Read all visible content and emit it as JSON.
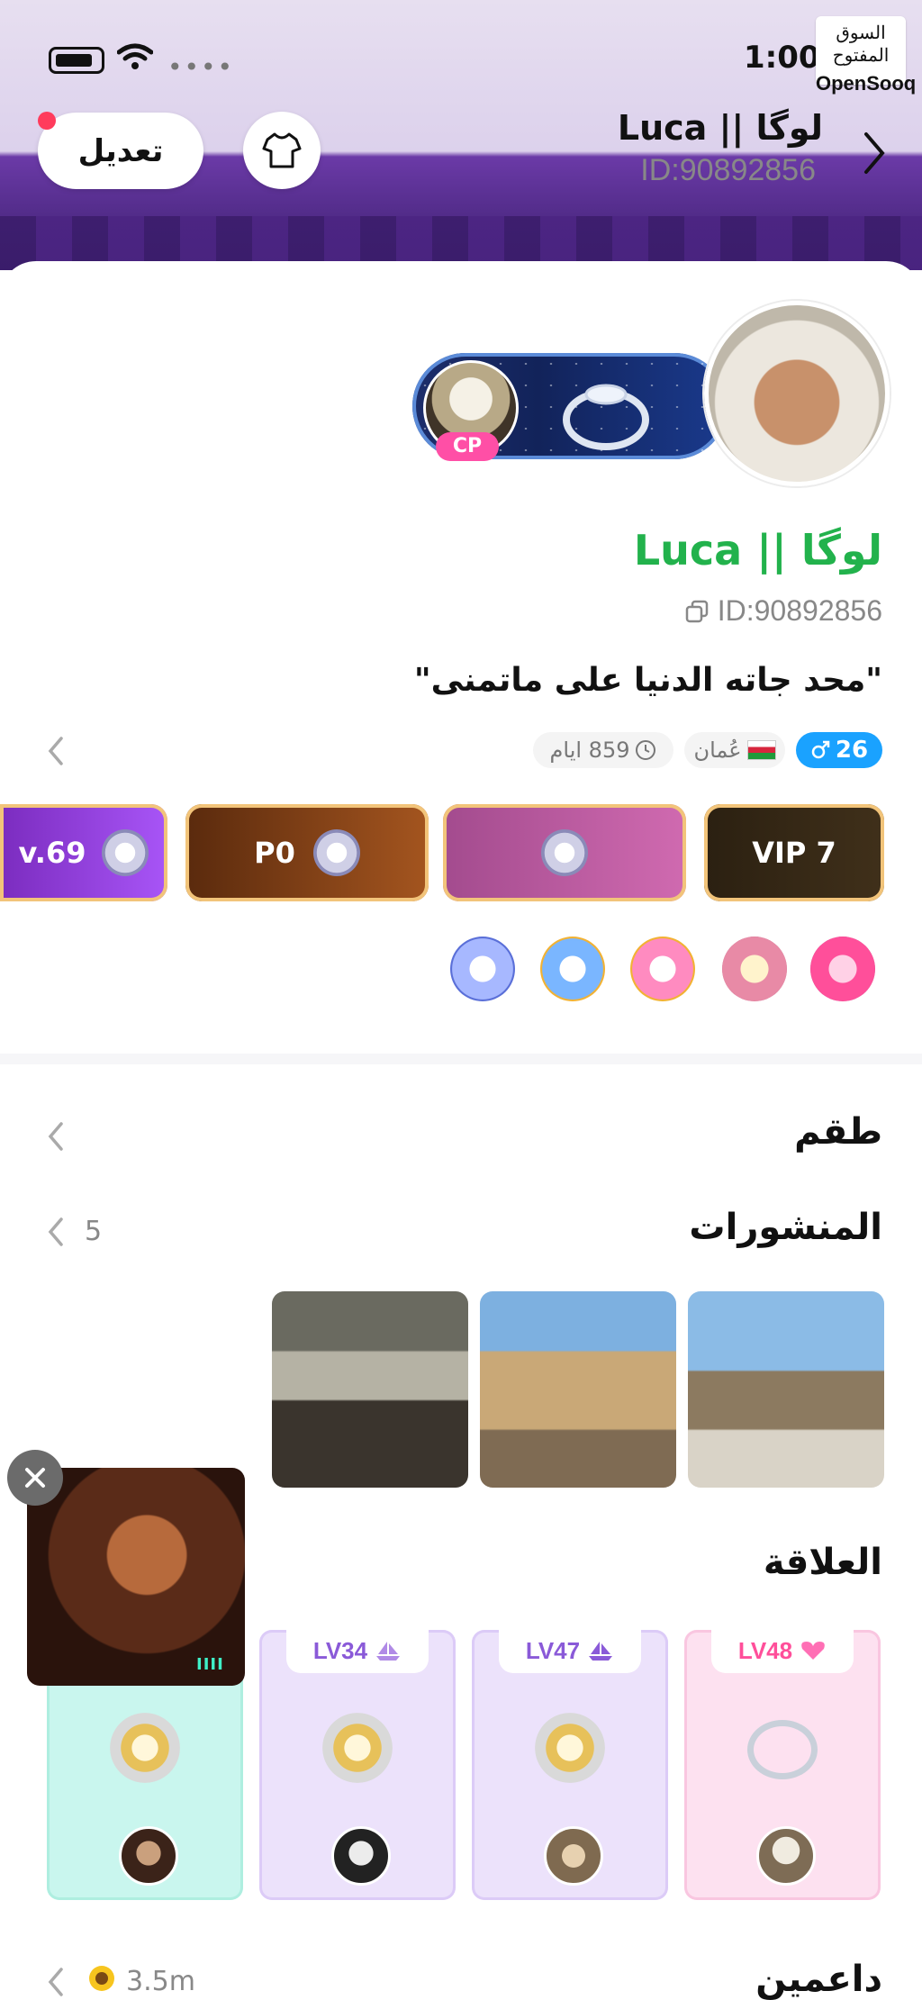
{
  "status": {
    "time": "1:00",
    "dots": "••••"
  },
  "watermark": {
    "line1": "السوق المفتوح",
    "line2": "OpenSooq"
  },
  "header": {
    "edit_label": "تعديل",
    "name": "لوگا || Luca",
    "id_text": "ID:90892856"
  },
  "profile": {
    "cp_label": "CP",
    "name": "لوگا || Luca",
    "id_text": "ID:90892856",
    "bio": "\"محد جاته الدنيا على ماتمنى\"",
    "age": "26",
    "country": "عُمان",
    "days": "859 ايام"
  },
  "ranks": {
    "vip": "VIP 7",
    "po": "P0",
    "lv": "v.69"
  },
  "sections": {
    "taqm": "طقم",
    "posts": "المنشورات",
    "posts_count": "5",
    "relation": "العلاقة",
    "supporters": "داعمين",
    "supporters_value": "3.5m"
  },
  "relations": [
    {
      "level": "LV48"
    },
    {
      "level": "LV47"
    },
    {
      "level": "LV34"
    },
    {
      "level": ""
    }
  ],
  "float_video": {
    "indicator": "IIII"
  },
  "colors": {
    "accent_green": "#22b24c",
    "tag_blue": "#1aa2ff",
    "notify_red": "#ff3b5c"
  }
}
